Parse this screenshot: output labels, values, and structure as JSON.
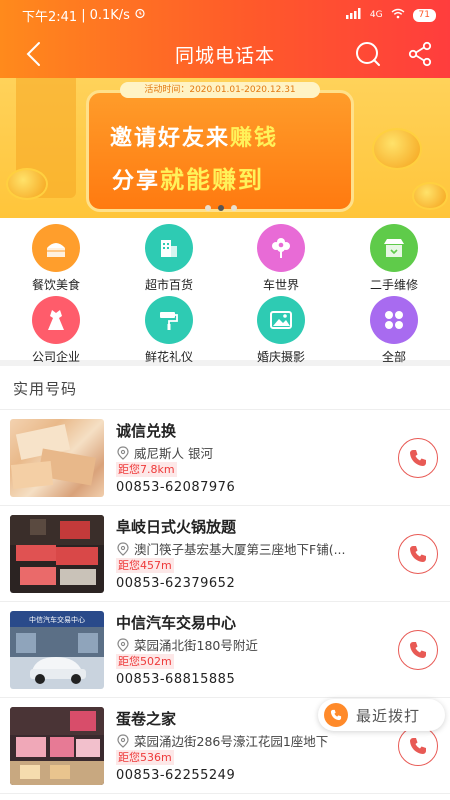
{
  "status_bar": {
    "time": "下午2:41",
    "speed": "0.1K/s",
    "battery": "71",
    "network": "4G"
  },
  "header": {
    "title": "同城电话本"
  },
  "banner": {
    "date_range": "活动时间：2020.01.01-2020.12.31",
    "line1_prefix": "邀请好友来",
    "line1_highlight": "赚钱",
    "line2_prefix": "分享",
    "line2_highlight": "就能赚到",
    "active_slide": 2,
    "total_slides": 3
  },
  "categories": [
    {
      "label": "餐饮美食",
      "icon": "cake-icon",
      "color": "#ff9e2c"
    },
    {
      "label": "超市百货",
      "icon": "building-icon",
      "color": "#2ecbb3"
    },
    {
      "label": "车世界",
      "icon": "flower-icon",
      "color": "#e86bd6"
    },
    {
      "label": "二手维修",
      "icon": "store-icon",
      "color": "#5fcb4a"
    },
    {
      "label": "公司企业",
      "icon": "dress-icon",
      "color": "#ff5c6b"
    },
    {
      "label": "鲜花礼仪",
      "icon": "brush-icon",
      "color": "#2ecbb3"
    },
    {
      "label": "婚庆摄影",
      "icon": "photo-icon",
      "color": "#2ecbb3"
    },
    {
      "label": "全部",
      "icon": "grid-icon",
      "color": "#a86bf0"
    }
  ],
  "section": {
    "title": "实用号码"
  },
  "listings": [
    {
      "name": "诚信兑换",
      "address": "威尼斯人 银河",
      "distance": "距您7.8km",
      "phone": "00853-62087976",
      "thumb": "money"
    },
    {
      "name": "阜岐日式火锅放题",
      "address": "澳门筷子基宏基大厦第三座地下F铺(...",
      "distance": "距您457m",
      "phone": "00853-62379652",
      "thumb": "hotpot"
    },
    {
      "name": "中信汽车交易中心",
      "address": "菜园涌北街180号附近",
      "distance": "距您502m",
      "phone": "00853-68815885",
      "thumb": "car"
    },
    {
      "name": "蛋卷之家",
      "address": "菜园涌边街286号濠江花园1座地下",
      "distance": "距您536m",
      "phone": "00853-62255249",
      "thumb": "shop"
    }
  ],
  "recent_calls": {
    "label": "最近拨打"
  }
}
